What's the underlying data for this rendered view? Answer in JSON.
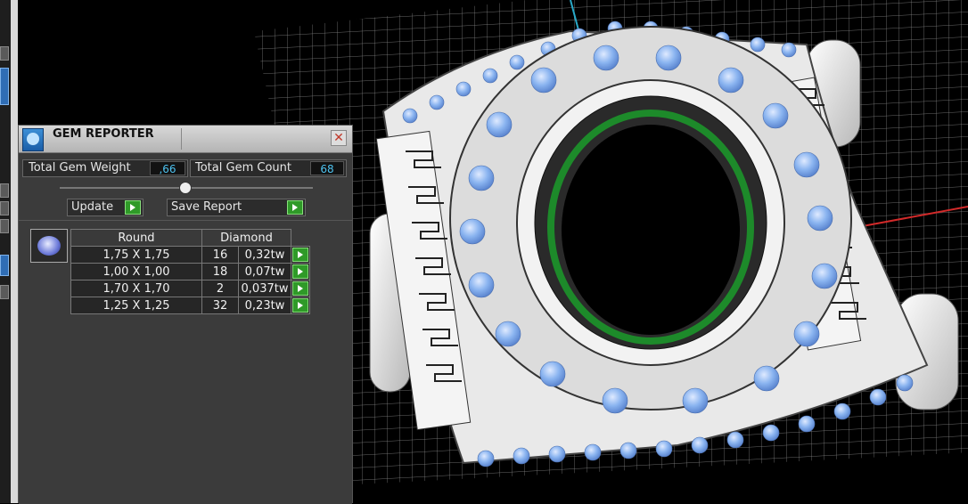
{
  "panel": {
    "title": "GEM REPORTER",
    "close_glyph": "✕",
    "total_gem_weight_label": "Total Gem Weight",
    "total_gem_weight_value": ",66",
    "total_gem_count_label": "Total Gem Count",
    "total_gem_count_value": "68",
    "update_label": "Update",
    "save_report_label": "Save Report"
  },
  "table": {
    "headers": [
      "Round",
      "Diamond"
    ],
    "rows": [
      {
        "size": "1,75 X 1,75",
        "count": "16",
        "weight": "0,32tw"
      },
      {
        "size": "1,00 X 1,00",
        "count": "18",
        "weight": "0,07tw"
      },
      {
        "size": "1,70 X 1,70",
        "count": "2",
        "weight": "0,037tw"
      },
      {
        "size": "1,25 X 1,25",
        "count": "32",
        "weight": "0,23tw"
      }
    ]
  },
  "icons": {
    "title": "gem-reporter-app-icon",
    "thumb": "round-gem-icon",
    "go": "play-arrow-icon",
    "close": "close-icon"
  },
  "colors": {
    "panel_bg": "#3b3b3b",
    "value_text": "#4ec3f0",
    "go_button": "#2f9a28",
    "gem_blue": "#8ab4f0",
    "grid": "#8a8a8a",
    "axis_red": "#d22a2a",
    "axis_cyan": "#29a9c8",
    "inner_ring_green": "#1d8a2a"
  }
}
